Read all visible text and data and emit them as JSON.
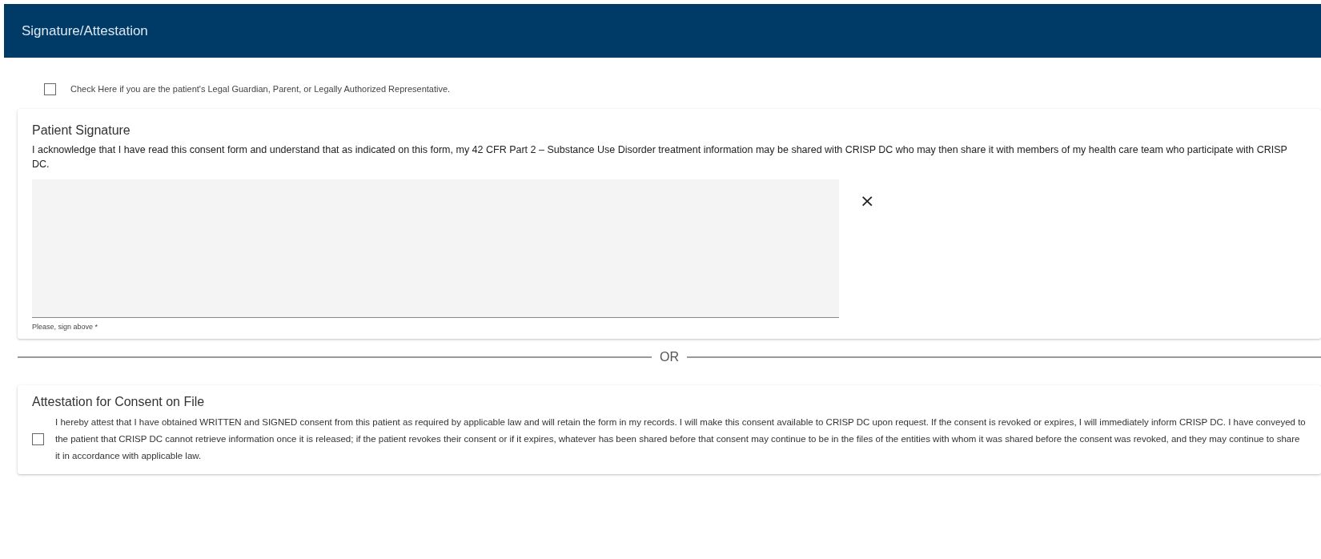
{
  "header": {
    "title": "Signature/Attestation"
  },
  "guardian_checkbox": {
    "label": "Check Here if you are the patient's Legal Guardian, Parent, or Legally Authorized Representative.",
    "checked": false
  },
  "patient_signature": {
    "title": "Patient Signature",
    "text": "I acknowledge that I have read this consent form and understand that as indicated on this form, my 42 CFR Part 2 – Substance Use Disorder treatment information may be shared with CRISP DC who may then share it with members of my health care team who participate with CRISP DC.",
    "clear_button": "×",
    "hint": "Please, sign above *"
  },
  "divider": {
    "label": "OR"
  },
  "attestation": {
    "title": "Attestation for Consent on File",
    "checked": false,
    "text": "I hereby attest that I have obtained WRITTEN and SIGNED consent from this patient as required by applicable law and will retain the form in my records. I will make this consent available to CRISP DC upon request. If the consent is revoked or expires, I will immediately inform CRISP DC. I have conveyed to the patient that CRISP DC cannot retrieve information once it is released; if the patient revokes their consent or if it expires, whatever has been shared before that consent may continue to be in the files of the entities with whom it was shared before the consent was revoked, and they may continue to share it in accordance with applicable law."
  }
}
